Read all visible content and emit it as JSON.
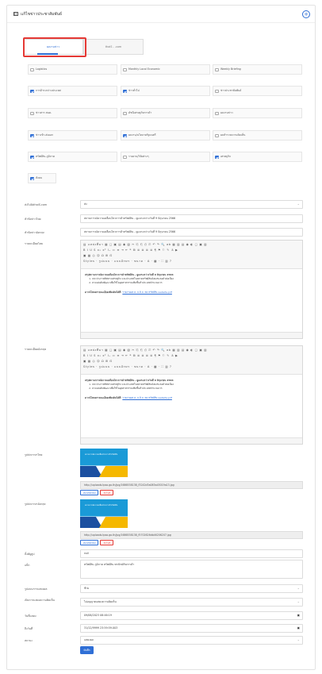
{
  "header": {
    "title": "แก้ไขข่าวประชาสัมพันธ์",
    "add_icon": "plus-circle-icon"
  },
  "tabs": [
    {
      "label": "ผลงานข่าว"
    },
    {
      "label": "thaiS - .com"
    }
  ],
  "categories": [
    {
      "label": "Logistics",
      "checked": false
    },
    {
      "label": "Monthly Local Economic",
      "checked": false
    },
    {
      "label": "Weekly Briefing",
      "checked": false
    },
    {
      "label": "การค้าระหว่างประเทศ",
      "checked": true
    },
    {
      "label": "ข่าวทั่วไป",
      "checked": true
    },
    {
      "label": "ข่าวประชาสัมพันธ์",
      "checked": false
    },
    {
      "label": "ข่าวสาร สนค.",
      "checked": false
    },
    {
      "label": "ดัชนีเศรษฐกิจการค้า",
      "checked": false
    },
    {
      "label": "ผลงานข่าว",
      "checked": false
    },
    {
      "label": "ข่าวเข้า-ส่งออก",
      "checked": true
    },
    {
      "label": "ผลงาน/นโยบายรัฐมนตรี",
      "checked": true
    },
    {
      "label": "ผลสำรวจความคิดเห็น",
      "checked": false
    },
    {
      "label": "ทรัพย์สิน-ภูมิภาค",
      "checked": true
    },
    {
      "label": "รายงาน/วิจัยต่างๆ",
      "checked": false
    },
    {
      "label": "เศรษฐกิจ",
      "checked": true
    },
    {
      "label": "สังคม",
      "checked": true
    }
  ],
  "fields": {
    "publish_label": "ส่งไปยังthaiS.com",
    "publish_value": "ส่ง",
    "title_th_label": "หัวข้อข่าวไทย",
    "title_th_value": "สถานการณ์ความเคลื่อนไหวการค้าทรัพย์สิน - ดูแลระหว่างวันที่ 9 มิถุนายน 2566",
    "title_en_label": "หัวข้อข่าวอังกฤษ",
    "title_en_value": "สถานการณ์ความเคลื่อนไหวการค้าทรัพย์สิน - ดูแลระหว่างวันที่ 9 มิถุนายน 2566",
    "detail_th_label": "รายละเอียดไทย",
    "detail_en_label": "รายละเอียดอังกฤษ",
    "image_th_label": "รูปปกภาษาไทย",
    "image_en_label": "รูปปกภาษาอังกฤษ",
    "tags_label": "ลิ้งค์ยูทูป",
    "tags_value": "null",
    "keywords_label": "แท็ก",
    "keywords_value": "ทรัพย์สิน ภูมิภาค ทรัพย์สิน พาณิชย์กิจการค้า",
    "display_label": "รูปแบบการแสดงผล",
    "display_value": "ซ้าย",
    "open_label": "เปิดการแสดงความคิดเห็น",
    "open_value": "ไม่อนุญาตแสดงความคิดเห็น",
    "start_label": "วันที่แสดง",
    "start_value": "09/06/2023 08:46:19",
    "end_label": "ถึงวันที่",
    "end_value": "31/12/9999 23:59:59.003",
    "status_label": "สถานะ",
    "status_value": "แสดงผล",
    "save_label": "บันทึก"
  },
  "editor": {
    "toolbar1": "▤ แหล่งที่มา ▦ ▢ ▣ ▤ ◉ ▧ ✂ ⎘ ⎗ ⎙ ⎚ ↶ ↷ 🔍 ab ▦ ▥ ▤ ◉ ◐ ▢ ▣ ▥",
    "toolbar2": "B I U S x₂ x² Iₓ ≔ ≡ ⇥ ⇤ ❝ ⊞ ≣ ≣ ≣ ≣ ¶ ⚑ ⚐ ✎ ⚓ ▶",
    "toolbar3": "▣ ▦ ◎ ☺ Ω ⊞ ⊡",
    "toolbar4": "Styles · รูปแบบ · แบบอักษร · ขนาด · A · ▩ · ⛶ ▥ ?",
    "heading": "สรุปสถานการณ์ความเคลื่อนไหวการค้าทรัพย์สิน - ดูแลระหว่างวันที่ 9 มิถุนายน 2566",
    "item1": "UN ประกาศทิศทางเศรษฐกิจ และประเทศในตลาดทรัพย์สินยังคงชะลอตัวต่อเนื่อง",
    "item2": "ยางแผ่นดิบพัฒนาเพื่อใช้ในอุตสาหกรรมเพิ่มขึ้นทั่วประเทศจำนวนมาก",
    "link_label": "ดาวน์โหลดรายละเอียดเพิ่มเติมได้ที่:",
    "link_text": "รายงานผล ค. 9 มิ.ย. 66 ทรัพย์สิน website.pdf"
  },
  "images": {
    "th": {
      "url": "http://uploads.tpso.go.th/jpg/1686538138_f3242d3a085a45019a13.jpg",
      "change": "อัพโหลดใหม่",
      "delete": "ลบไฟล์",
      "caption": "สถานการณ์ความเคลื่อนไหวการค้าทรัพย์สิน"
    },
    "en": {
      "url": "http://uploads.tpso.go.th/jpg/1686538138_f5702626db46206207.jpg",
      "change": "อัพโหลดใหม่",
      "delete": "ลบไฟล์",
      "caption": "สถานการณ์ความเคลื่อนไหวการค้าทรัพย์สิน"
    }
  }
}
